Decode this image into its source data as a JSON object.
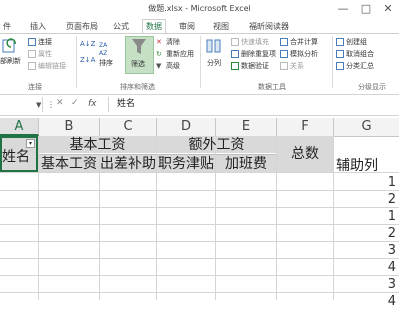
{
  "window": {
    "title": "做题.xlsx - Microsoft Excel"
  },
  "tabs": [
    "件",
    "插入",
    "页面布局",
    "公式",
    "数据",
    "审阅",
    "视图",
    "福昕阅读器"
  ],
  "ribbon": {
    "refresh_label": "部刷新",
    "connections": [
      "连接",
      "属性",
      "编辑链接"
    ],
    "connections_group": "连接",
    "sort_label": "排序",
    "filter_label": "筛选",
    "clear_label": "清除",
    "reapply_label": "重新应用",
    "advanced_label": "高级",
    "sort_filter_group": "排序和筛选",
    "split_label": "分列",
    "flash_fill_label": "快速填充",
    "remove_dup_label": "删除重复项",
    "validation_label": "数据验证",
    "consolidate_label": "合并计算",
    "whatif_label": "模拟分析",
    "relationships_label": "关系",
    "data_tools_group": "数据工具",
    "group_label": "创建组",
    "ungroup_label": "取消组合",
    "subtotal_label": "分类汇总",
    "outline_group": "分级显示"
  },
  "formula_bar": {
    "name_box": "",
    "fx": "fx",
    "content": "姓名"
  },
  "columns": [
    "A",
    "B",
    "C",
    "D",
    "E",
    "F",
    "G"
  ],
  "header": {
    "a": "姓名",
    "basic": "基本工资",
    "basic_sub1": "基本工资",
    "basic_sub2": "出差补助",
    "extra": "额外工资",
    "extra_sub1": "职务津贴",
    "extra_sub2": "加班费",
    "total": "总数",
    "helper": "辅助列"
  },
  "helper_values": [
    "1",
    "2",
    "1",
    "2",
    "3",
    "4",
    "3",
    "4"
  ]
}
